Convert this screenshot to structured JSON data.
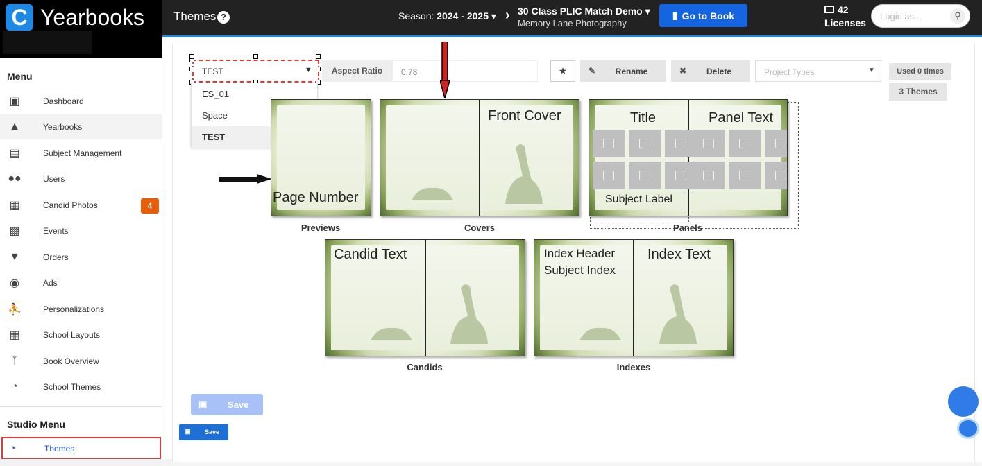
{
  "app": {
    "name": "Yearbooks",
    "page_title": "Themes"
  },
  "header": {
    "season_label": "Season:",
    "season_value": "2024 - 2025",
    "book_title": "30 Class PLIC Match Demo",
    "book_subtitle": "Memory Lane Photography",
    "goto_label": "Go to Book",
    "licenses_count": "42",
    "licenses_label": "Licenses",
    "login_placeholder": "Login as..."
  },
  "sidebar": {
    "menu_title": "Menu",
    "items": [
      {
        "label": "Dashboard",
        "icon": "dashboard-icon"
      },
      {
        "label": "Yearbooks",
        "icon": "graduation-cap-icon"
      },
      {
        "label": "Subject Management",
        "icon": "id-card-icon"
      },
      {
        "label": "Users",
        "icon": "users-icon"
      },
      {
        "label": "Candid Photos",
        "icon": "photo-icon",
        "badge": "4"
      },
      {
        "label": "Events",
        "icon": "calendar-icon"
      },
      {
        "label": "Orders",
        "icon": "cart-icon"
      },
      {
        "label": "Ads",
        "icon": "basket-icon"
      },
      {
        "label": "Personalizations",
        "icon": "person-icon"
      },
      {
        "label": "School Layouts",
        "icon": "layout-icon"
      },
      {
        "label": "Book Overview",
        "icon": "fork-icon"
      },
      {
        "label": "School Themes",
        "icon": "palette-icon"
      }
    ],
    "studio_title": "Studio Menu",
    "studio_items": [
      {
        "label": "Themes",
        "icon": "palette-icon"
      }
    ]
  },
  "toolbar": {
    "theme_selected": "TEST",
    "theme_options": [
      "ES_01",
      "Space",
      "TEST"
    ],
    "aspect_label": "Aspect Ratio",
    "aspect_value": "0.78",
    "rename_label": "Rename",
    "delete_label": "Delete",
    "project_types_placeholder": "Project Types",
    "used_label": "Used 0 times",
    "themes_count": "3 Themes"
  },
  "thumbnails": {
    "previews": {
      "caption": "Previews",
      "text": "Page Number"
    },
    "covers": {
      "caption": "Covers",
      "text": "Front Cover"
    },
    "panels": {
      "caption": "Panels",
      "title": "Title",
      "panel_text": "Panel Text",
      "subject_label": "Subject Label"
    },
    "candids": {
      "caption": "Candids",
      "text": "Candid Text"
    },
    "indexes": {
      "caption": "Indexes",
      "header": "Index Header",
      "subject_index": "Subject Index",
      "text": "Index Text"
    }
  },
  "actions": {
    "save_label": "Save",
    "save_label_small": "Save"
  },
  "colors": {
    "accent": "#1e88e5",
    "highlight": "#e53935",
    "badge": "#e85d0a"
  }
}
